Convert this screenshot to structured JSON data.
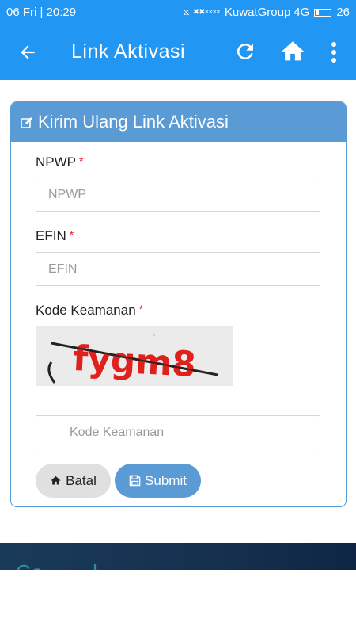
{
  "status_bar": {
    "time": "06 Fri  |  20:29",
    "carrier": "KuwatGroup",
    "network": "4G",
    "battery": "26"
  },
  "app_bar": {
    "title": "Link Aktivasi",
    "icons": [
      "back-arrow-icon",
      "refresh-icon",
      "home-icon",
      "more-vert-icon"
    ]
  },
  "form": {
    "header_title": "Kirim Ulang Link Aktivasi",
    "header_icon": "edit-icon",
    "required_mark": "*",
    "npwp": {
      "label": "NPWP",
      "placeholder": "NPWP",
      "value": ""
    },
    "efin": {
      "label": "EFIN",
      "placeholder": "EFIN",
      "value": ""
    },
    "security": {
      "label": "Kode Keamanan",
      "captcha_text": "fygm8",
      "placeholder": "Kode Keamanan",
      "value": ""
    },
    "buttons": {
      "cancel": "Batal",
      "submit": "Submit"
    }
  },
  "colors": {
    "app_bar": "#2196f3",
    "card_header": "#5b9bd5",
    "required": "#d9232f",
    "captcha_text": "#e0201c"
  }
}
